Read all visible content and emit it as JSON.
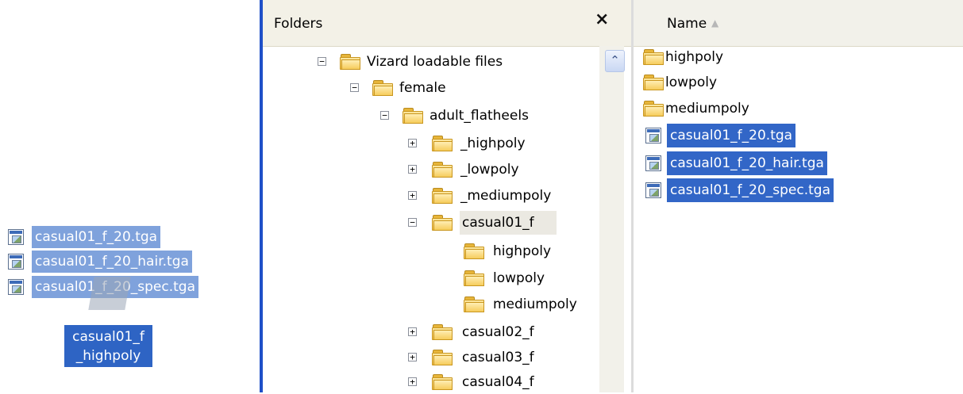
{
  "drag_ghost": {
    "files": [
      "casual01_f_20.tga",
      "casual01_f_20_hair.tga",
      "casual01_f_20_spec.tga"
    ],
    "target_line1": "casual01_f",
    "target_line2": "_highpoly"
  },
  "folders_pane": {
    "title": "Folders",
    "close_glyph": "×",
    "scroll_up_glyph": "⌃",
    "tree": [
      {
        "label": "Vizard loadable files",
        "expander": "−"
      },
      {
        "label": "female",
        "expander": "−"
      },
      {
        "label": "adult_flatheels",
        "expander": "−"
      },
      {
        "label": "_highpoly",
        "expander": "+"
      },
      {
        "label": "_lowpoly",
        "expander": "+"
      },
      {
        "label": "_mediumpoly",
        "expander": "+"
      },
      {
        "label": "casual01_f",
        "expander": "−"
      },
      {
        "label": "highpoly",
        "expander": ""
      },
      {
        "label": "lowpoly",
        "expander": ""
      },
      {
        "label": "mediumpoly",
        "expander": ""
      },
      {
        "label": "casual02_f",
        "expander": "+"
      },
      {
        "label": "casual03_f",
        "expander": "+"
      },
      {
        "label": "casual04_f",
        "expander": "+"
      }
    ]
  },
  "list_pane": {
    "column_name": "Name",
    "sort_glyph": "▲",
    "items": [
      {
        "label": "highpoly",
        "type": "folder"
      },
      {
        "label": "lowpoly",
        "type": "folder"
      },
      {
        "label": "mediumpoly",
        "type": "folder"
      },
      {
        "label": "casual01_f_20.tga",
        "type": "tga"
      },
      {
        "label": "casual01_f_20_hair.tga",
        "type": "tga"
      },
      {
        "label": "casual01_f_20_spec.tga",
        "type": "tga"
      }
    ]
  }
}
